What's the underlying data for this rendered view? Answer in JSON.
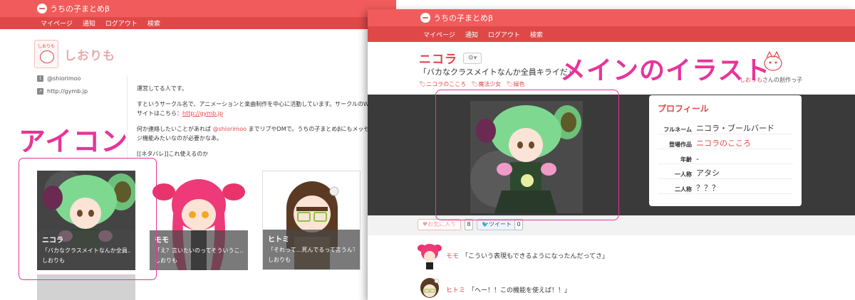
{
  "app": {
    "logo_text": "うちの子まとめβ"
  },
  "nav": [
    "マイページ",
    "通知",
    "ログアウト",
    "検索"
  ],
  "left_page": {
    "profile_name": "しおりも",
    "avatar_label": "しおりも",
    "links": [
      {
        "icon": "twitter-icon",
        "text": "@shiorimoo"
      },
      {
        "icon": "link-icon",
        "text": "http://gymb.jp"
      }
    ],
    "bio": {
      "p1": "運営してる人です。",
      "p2_before": "すというサークル名で、アニメーションと楽曲制作を中心に活動しています。サークルのWebサイトはこちら：",
      "p2_link": "http://gymb.jp",
      "p3_before": "何か連絡したいことがあれば ",
      "p3_mention": "@shiorimoo",
      "p3_after": " までリプやDMで。うちの子まとめβにもメッセージ機能みたいなのが必要かなあ。",
      "p4": "[[ネタバレ]]これ使えるのか"
    },
    "cards": [
      {
        "name": "ニコラ",
        "quote": "「バカなクラスメイトなんか全員…",
        "author": "しおりも"
      },
      {
        "name": "モモ",
        "quote": "「え？言いたいのってそういうこ…",
        "author": "しおりも"
      },
      {
        "name": "ヒトミ",
        "quote": "「それって…死んでるって言うんで…",
        "author": "しおりも"
      }
    ]
  },
  "right_page": {
    "work_name": "ニコラ",
    "gear_label": "⚙▾",
    "quote": "「バカなクラスメイトなんか全員キライだ」",
    "tags": [
      "ニコラのこころ",
      "魔法少女",
      "緑色"
    ],
    "creator_name": "しおりも",
    "creator_suffix": "さんの創作っ子",
    "profile": {
      "title": "プロフィール",
      "rows": [
        {
          "key": "フルネーム",
          "value": "ニコラ・ブールバード",
          "pink": false
        },
        {
          "key": "登場作品",
          "value": "ニコラのこころ",
          "pink": true
        },
        {
          "key": "年齢",
          "value": "-",
          "pink": false
        },
        {
          "key": "一人称",
          "value": "アタシ",
          "pink": false
        },
        {
          "key": "二人称",
          "value": "？？？",
          "pink": false
        }
      ]
    },
    "actions": {
      "favorite_label": "♥お気に入り",
      "favorite_count": "8",
      "tweet_label": "ツイート",
      "tweet_count": "0"
    },
    "comments": [
      {
        "name": "モモ",
        "text": "「こういう表現もできるようになったんだってさ」"
      },
      {
        "name": "ヒトミ",
        "text": "「ヘー！！この機能を使えば！！」"
      }
    ]
  },
  "annotations": {
    "icon_label": "アイコン",
    "main_label": "メインのイラスト"
  },
  "colors": {
    "header": "#f25b5b",
    "nav": "#e04848",
    "accent": "#e04848",
    "annotation": "#e8349a"
  }
}
